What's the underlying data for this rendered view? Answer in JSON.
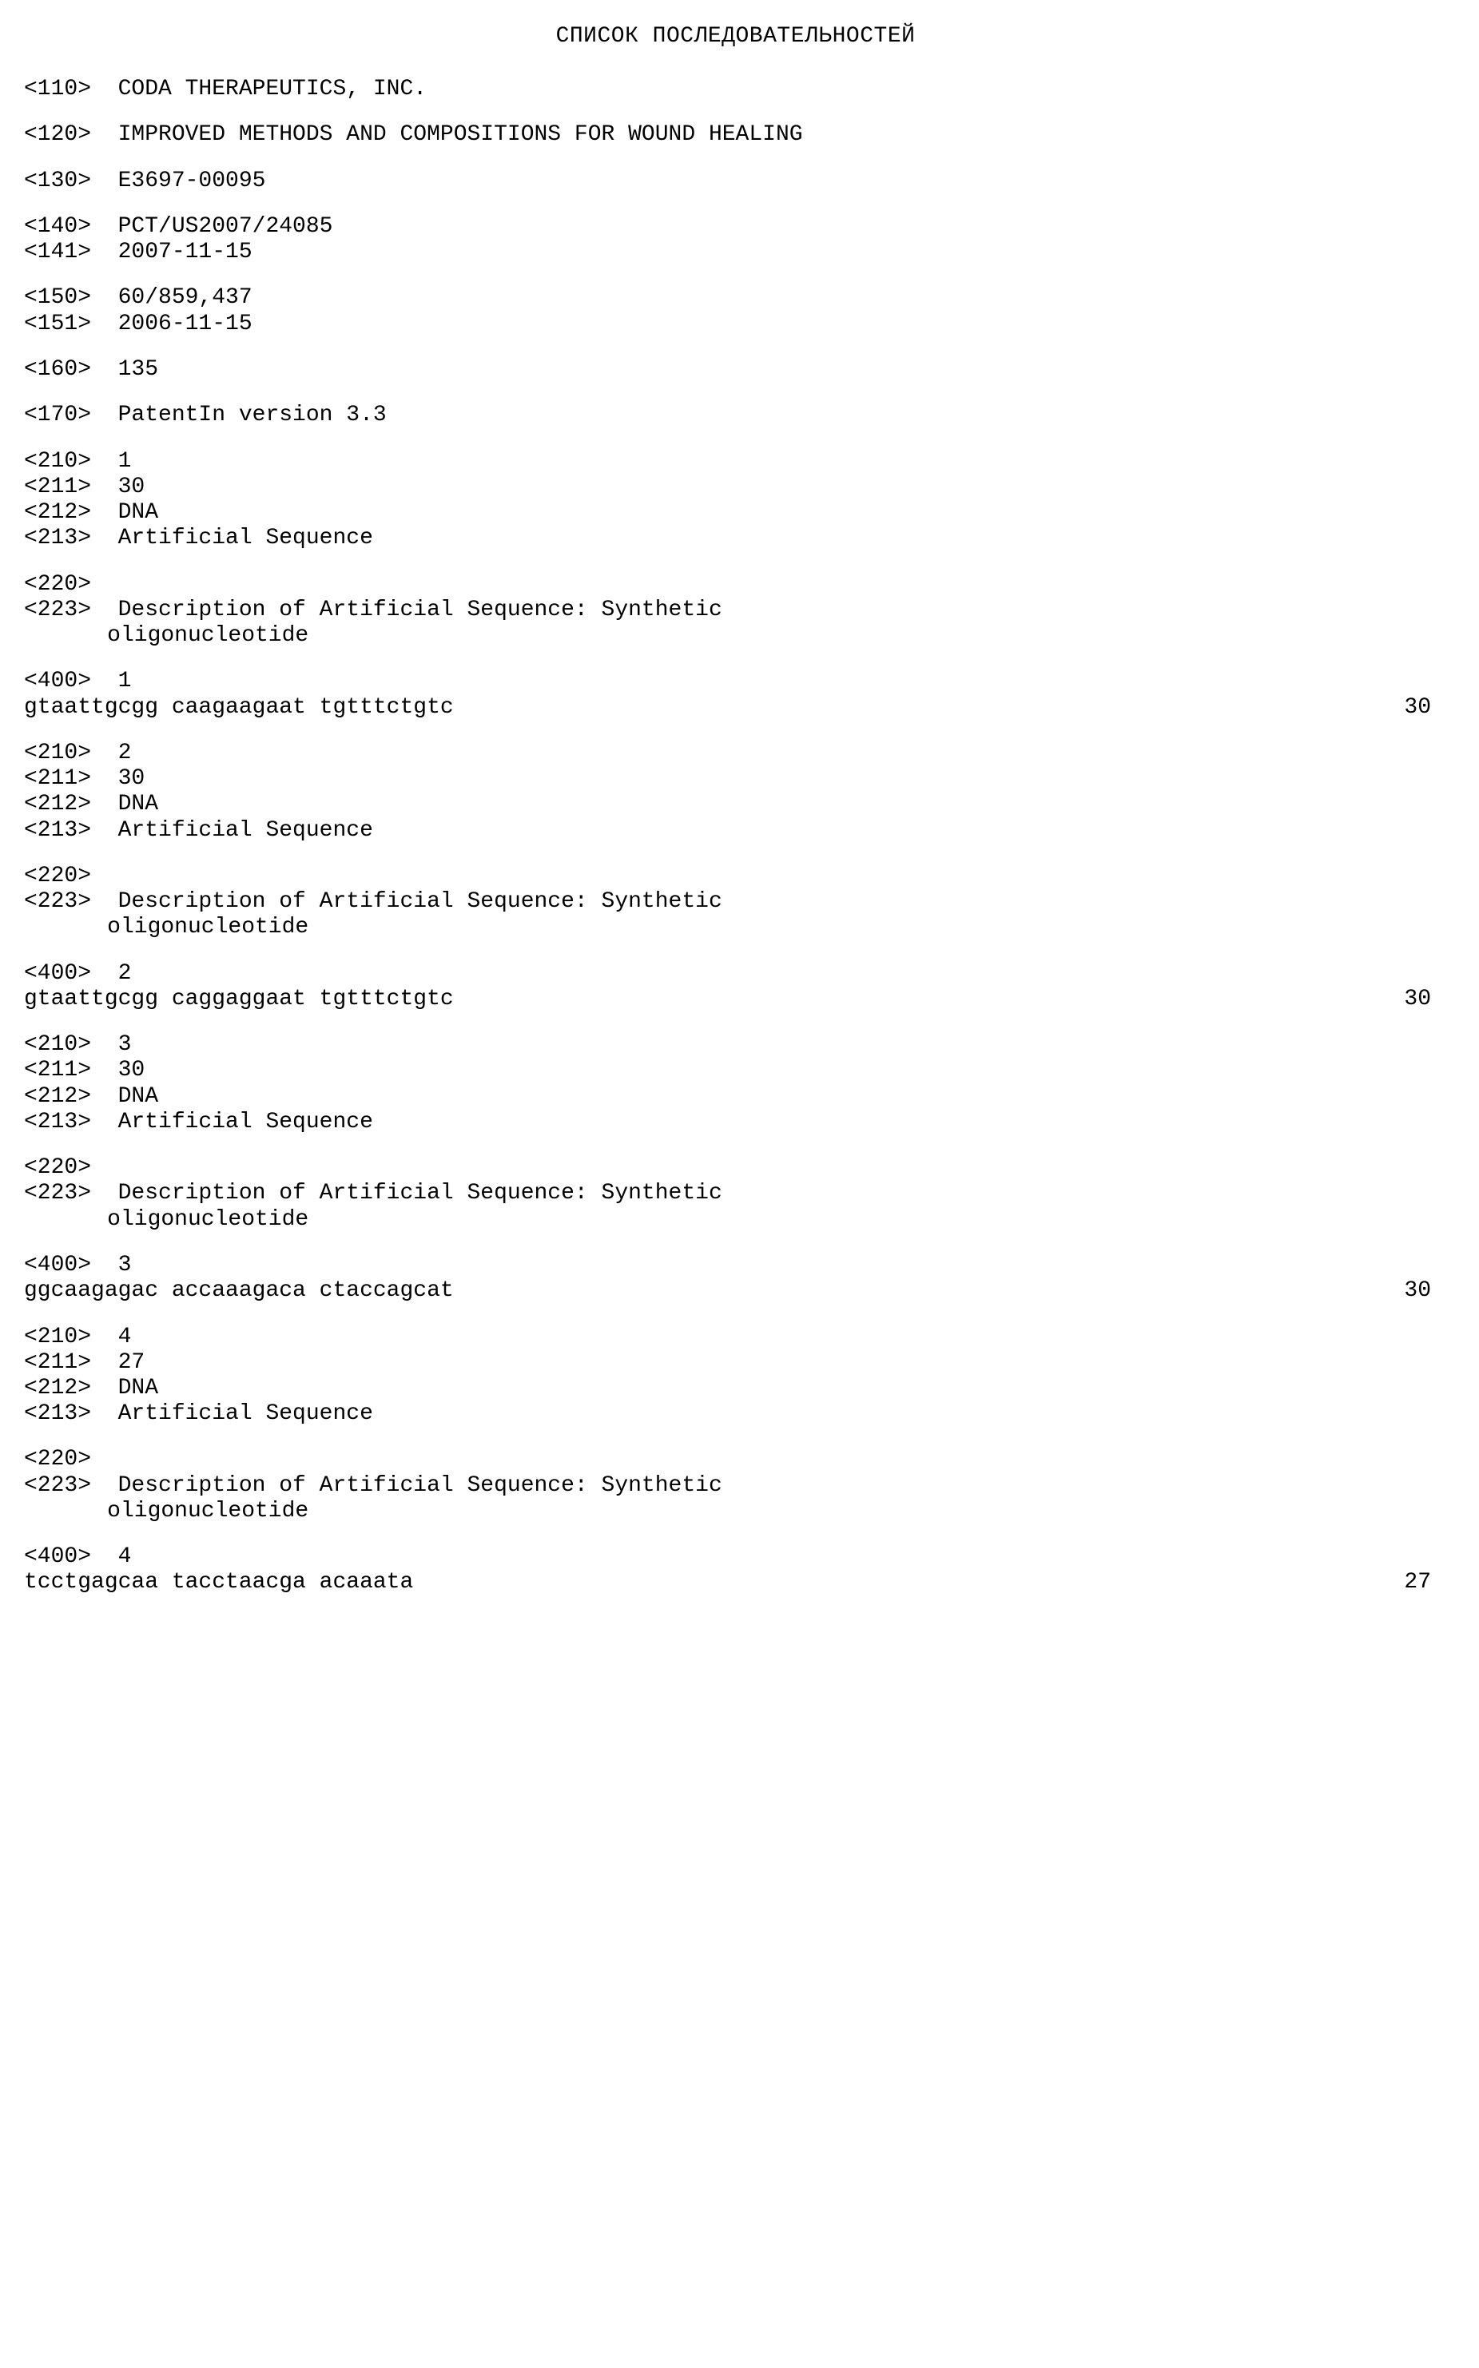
{
  "title": "СПИСОК ПОСЛЕДОВАТЕЛЬНОСТЕЙ",
  "header": {
    "l110": "<110>  CODA THERAPEUTICS, INC.",
    "l120": "<120>  IMPROVED METHODS AND COMPOSITIONS FOR WOUND HEALING",
    "l130": "<130>  E3697-00095",
    "l140": "<140>  PCT/US2007/24085",
    "l141": "<141>  2007-11-15",
    "l150": "<150>  60/859,437",
    "l151": "<151>  2006-11-15",
    "l160": "<160>  135",
    "l170": "<170>  PatentIn version 3.3"
  },
  "seqs": [
    {
      "l210": "<210>  1",
      "l211": "<211>  30",
      "l212": "<212>  DNA",
      "l213": "<213>  Artificial Sequence",
      "l220": "<220>",
      "l223a": "<223>  Description of Artificial Sequence: Synthetic",
      "l223b": "oligonucleotide",
      "l400": "<400>  1",
      "seq": "gtaattgcgg caagaagaat tgtttctgtc",
      "len": "30"
    },
    {
      "l210": "<210>  2",
      "l211": "<211>  30",
      "l212": "<212>  DNA",
      "l213": "<213>  Artificial Sequence",
      "l220": "<220>",
      "l223a": "<223>  Description of Artificial Sequence: Synthetic",
      "l223b": "oligonucleotide",
      "l400": "<400>  2",
      "seq": "gtaattgcgg caggaggaat tgtttctgtc",
      "len": "30"
    },
    {
      "l210": "<210>  3",
      "l211": "<211>  30",
      "l212": "<212>  DNA",
      "l213": "<213>  Artificial Sequence",
      "l220": "<220>",
      "l223a": "<223>  Description of Artificial Sequence: Synthetic",
      "l223b": "oligonucleotide",
      "l400": "<400>  3",
      "seq": "ggcaagagac accaaagaca ctaccagcat",
      "len": "30"
    },
    {
      "l210": "<210>  4",
      "l211": "<211>  27",
      "l212": "<212>  DNA",
      "l213": "<213>  Artificial Sequence",
      "l220": "<220>",
      "l223a": "<223>  Description of Artificial Sequence: Synthetic",
      "l223b": "oligonucleotide",
      "l400": "<400>  4",
      "seq": "tcctgagcaa tacctaacga acaaata",
      "len": "27"
    }
  ]
}
